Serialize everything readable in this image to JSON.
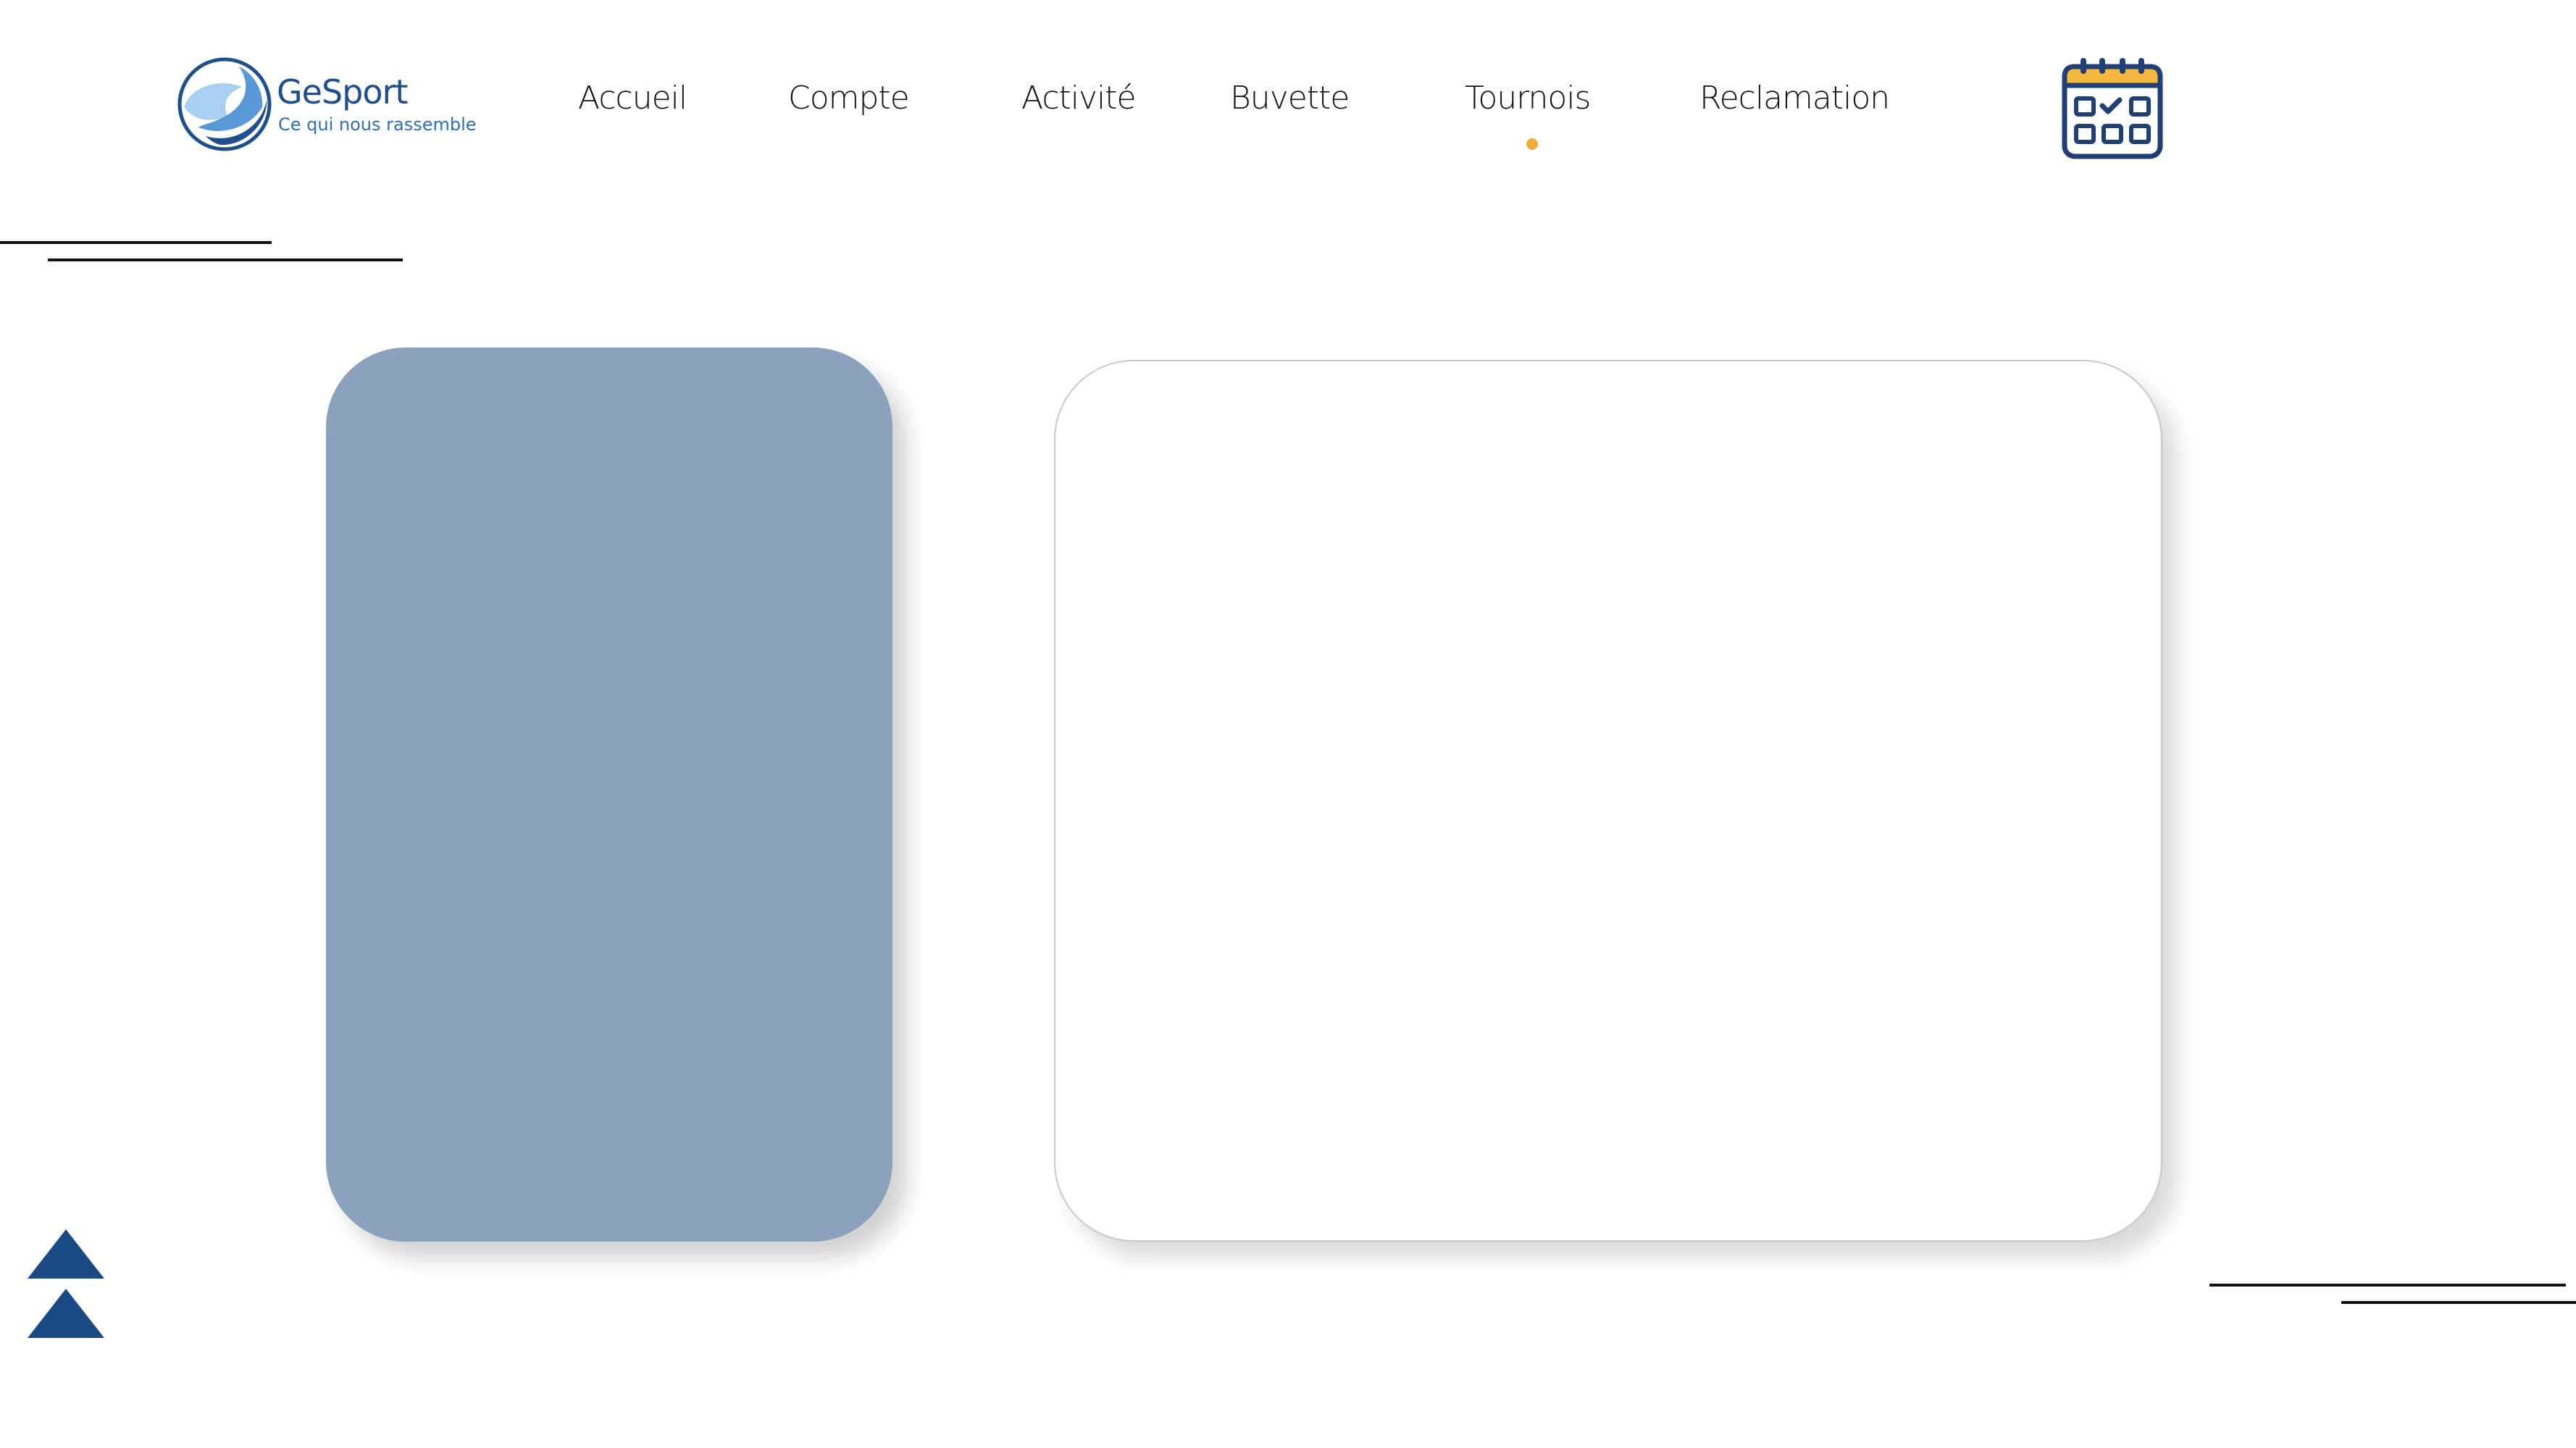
{
  "brand": {
    "title": "GeSport",
    "tagline": "Ce qui nous rassemble",
    "logo_icon": "wave-circle-logo"
  },
  "nav": {
    "items": [
      {
        "label": "Accueil"
      },
      {
        "label": "Compte"
      },
      {
        "label": "Activité"
      },
      {
        "label": "Buvette"
      },
      {
        "label": "Tournois",
        "active": true
      },
      {
        "label": "Reclamation"
      }
    ],
    "active_indicator_color": "#f2ab3c"
  },
  "header": {
    "calendar_icon": "calendar-check-icon"
  },
  "scroll_top_icon": "double-triangle-up-icon",
  "colors": {
    "primary": "#1f4e8c",
    "accent": "#f2ab3c",
    "card_blue": "#8ca1bb",
    "text": "#111111"
  }
}
